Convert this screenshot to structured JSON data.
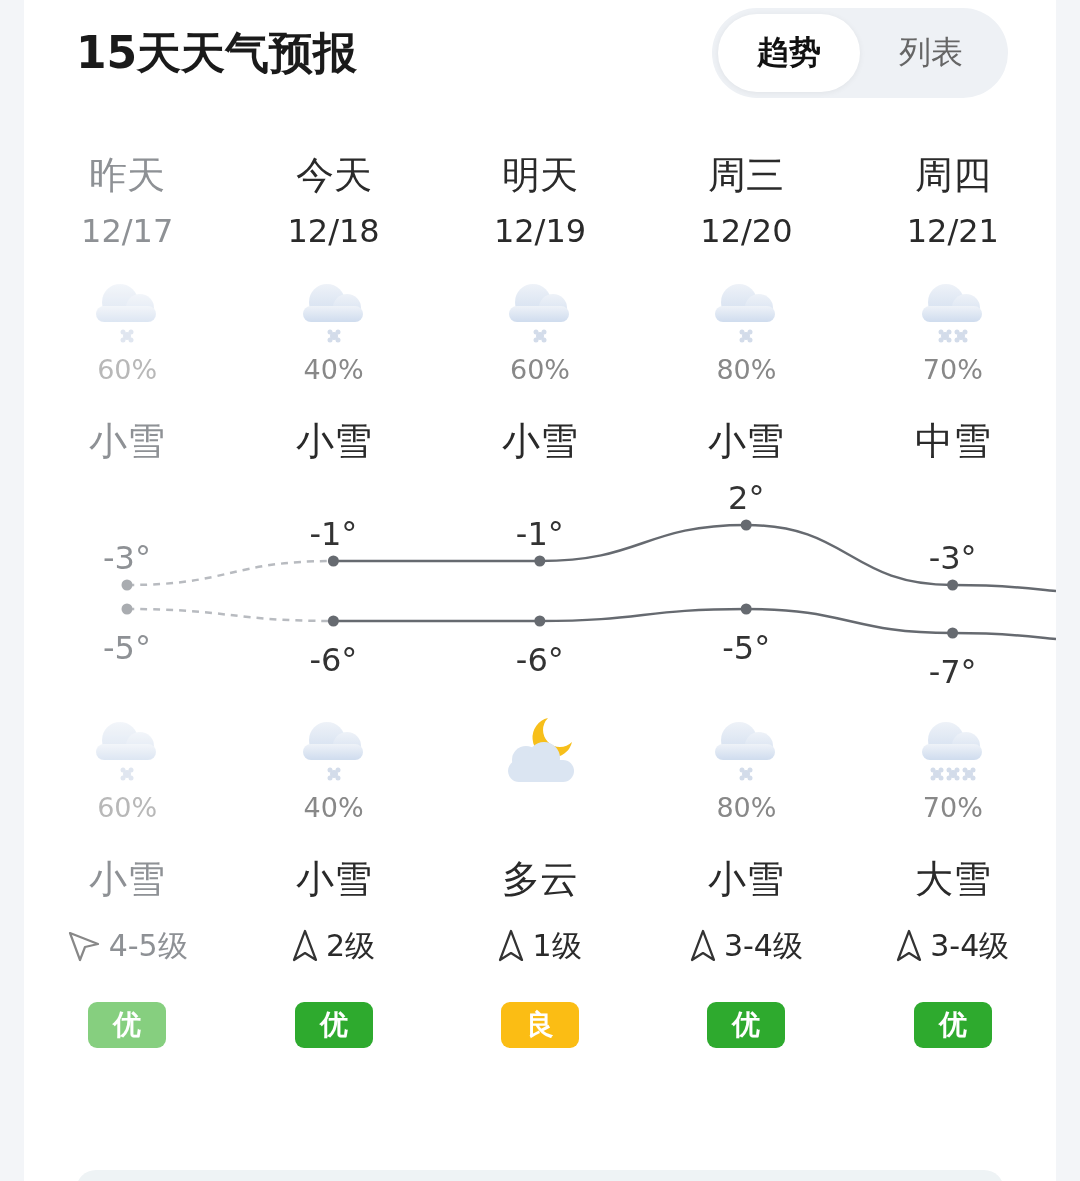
{
  "header": {
    "title": "15天天气预报"
  },
  "view_tabs": [
    {
      "label": "趋势",
      "selected": true
    },
    {
      "label": "列表",
      "selected": false
    }
  ],
  "days": [
    {
      "day": "昨天",
      "date": "12/17",
      "past": true,
      "day_icon": {
        "kind": "light_snow"
      },
      "day_precip": "60%",
      "day_condition": "小雪",
      "high": "-3°",
      "low": "-5°",
      "night_icon": {
        "kind": "light_snow"
      },
      "night_precip": "60%",
      "night_condition": "小雪",
      "wind": {
        "kind": "tilted",
        "label": "4-5级"
      },
      "aqi": {
        "label": "优",
        "color": "#86cf7f"
      }
    },
    {
      "day": "今天",
      "date": "12/18",
      "past": false,
      "day_icon": {
        "kind": "light_snow"
      },
      "day_precip": "40%",
      "day_condition": "小雪",
      "high": "-1°",
      "low": "-6°",
      "night_icon": {
        "kind": "light_snow"
      },
      "night_precip": "40%",
      "night_condition": "小雪",
      "wind": {
        "kind": "upright",
        "label": "2级"
      },
      "aqi": {
        "label": "优",
        "color": "#2eaa2e"
      }
    },
    {
      "day": "明天",
      "date": "12/19",
      "past": false,
      "day_icon": {
        "kind": "light_snow"
      },
      "day_precip": "60%",
      "day_condition": "小雪",
      "high": "-1°",
      "low": "-6°",
      "night_icon": {
        "kind": "moon_cloud"
      },
      "night_condition": "多云",
      "wind": {
        "kind": "upright",
        "label": "1级"
      },
      "aqi": {
        "label": "良",
        "color": "#fbbd14"
      }
    },
    {
      "day": "周三",
      "date": "12/20",
      "past": false,
      "day_icon": {
        "kind": "light_snow"
      },
      "day_precip": "80%",
      "day_condition": "小雪",
      "high": "2°",
      "low": "-5°",
      "night_icon": {
        "kind": "light_snow"
      },
      "night_precip": "80%",
      "night_condition": "小雪",
      "wind": {
        "kind": "upright",
        "label": "3-4级"
      },
      "aqi": {
        "label": "优",
        "color": "#2eaa2e"
      }
    },
    {
      "day": "周四",
      "date": "12/21",
      "past": false,
      "day_icon": {
        "kind": "moderate_snow"
      },
      "day_precip": "70%",
      "day_condition": "中雪",
      "high": "-3°",
      "low": "-7°",
      "night_icon": {
        "kind": "heavy_snow"
      },
      "night_precip": "70%",
      "night_condition": "大雪",
      "wind": {
        "kind": "upright",
        "label": "3-4级"
      },
      "aqi": {
        "label": "优",
        "color": "#2eaa2e"
      }
    }
  ]
}
